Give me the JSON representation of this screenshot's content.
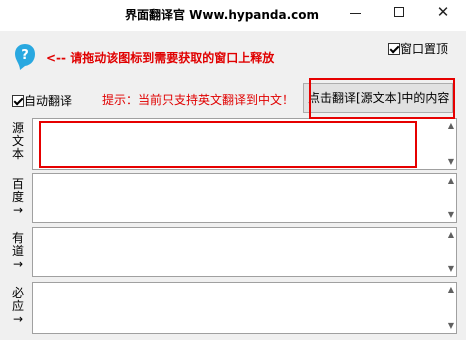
{
  "window": {
    "title": "界面翻译官  Www.hypanda.com"
  },
  "toolbar": {
    "drag_hint": "<--  请拖动该图标到需要获取的窗口上释放",
    "always_on_top_label": "窗口置顶",
    "auto_translate_label": "自动翻译",
    "notice": "提示：当前只支持英文翻译到中文！",
    "translate_button_label": "点击翻译[源文本]中的内容"
  },
  "rows": [
    {
      "label": "源文本",
      "chars": [
        "源",
        "文",
        "本"
      ],
      "value": ""
    },
    {
      "label": "百度→",
      "chars": [
        "百",
        "度",
        "→"
      ],
      "value": ""
    },
    {
      "label": "有道→",
      "chars": [
        "有",
        "道",
        "→"
      ],
      "value": ""
    },
    {
      "label": "必应→",
      "chars": [
        "必",
        "应",
        "→"
      ],
      "value": ""
    }
  ],
  "colors": {
    "accent_red": "#e00000",
    "highlight_box": "#e60000",
    "drag_icon": "#29a8e0"
  }
}
